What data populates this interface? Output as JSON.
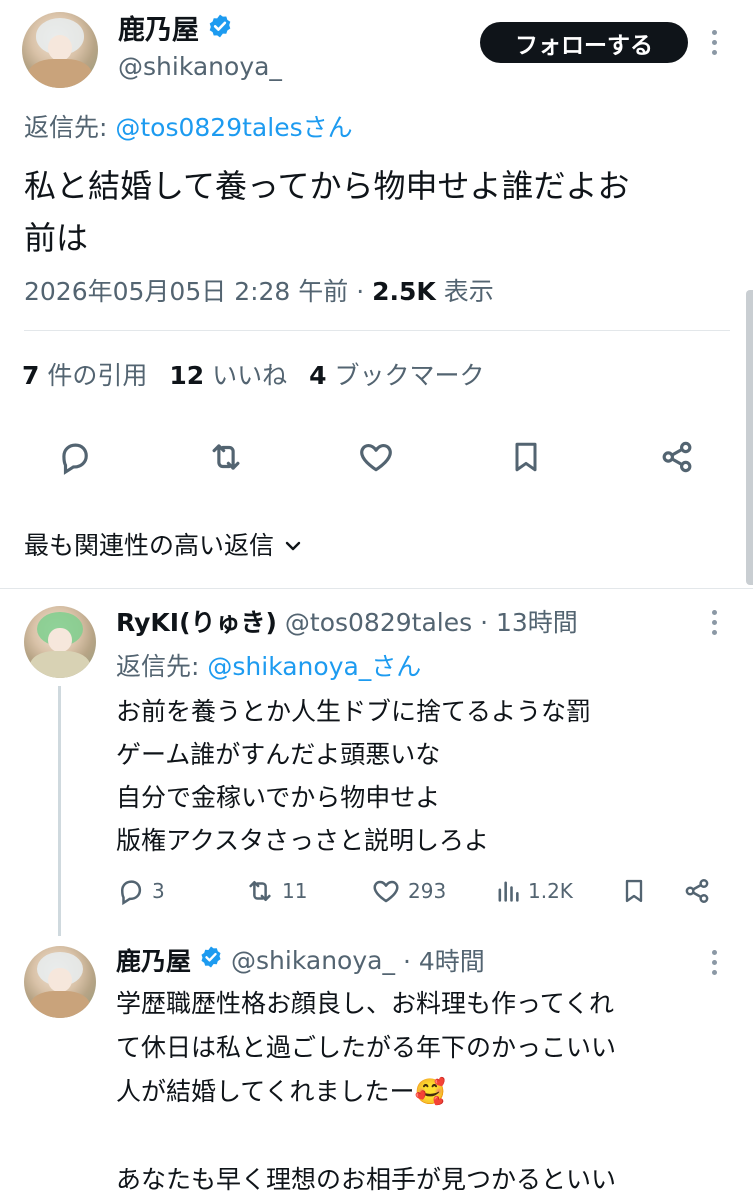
{
  "main_tweet": {
    "author_name": "鹿乃屋",
    "author_handle": "@shikanoya_",
    "follow_label": "フォローする",
    "reply_to_prefix": "返信先: ",
    "reply_to_handle": "@tos0829talesさん",
    "text_line1": "私と結婚して養ってから物申せよ誰だよお",
    "text_line2": "前は",
    "timestamp": "2026年05月05日 2:28 午前 · ",
    "views_count": "2.5K",
    "views_label": " 表示",
    "quotes_count": "7",
    "quotes_label": " 件の引用",
    "likes_count": "12",
    "likes_label": " いいね",
    "bookmarks_count": "4",
    "bookmarks_label": " ブックマーク"
  },
  "sort_label": "最も関連性の高い返信",
  "replies": [
    {
      "author_name": "RyKI(りゅき)",
      "author_handle": "@tos0829tales",
      "time": "· 13時間",
      "reply_to_prefix": "返信先: ",
      "reply_to_handle": "@shikanoya_さん",
      "lines": [
        "お前を養うとか人生ドブに捨てるような罰",
        "ゲーム誰がすんだよ頭悪いな",
        "自分で金稼いでから物申せよ",
        "版権アクスタさっさと説明しろよ"
      ],
      "reply_count": "3",
      "retweet_count": "11",
      "like_count": "293",
      "view_count": "1.2K"
    },
    {
      "author_name": "鹿乃屋",
      "author_handle": "@shikanoya_",
      "time": "· 4時間",
      "lines": [
        "学歴職歴性格お顔良し、お料理も作ってくれ",
        "て休日は私と過ごしたがる年下のかっこいい",
        "人が結婚してくれましたー🥰",
        "",
        "あなたも早く理想のお相手が見つかるといい"
      ]
    }
  ],
  "colors": {
    "text": "#0f1419",
    "secondary": "#536471",
    "accent": "#1d9bf0",
    "verified": "#1d9bf0",
    "button_bg": "#0f1419"
  }
}
